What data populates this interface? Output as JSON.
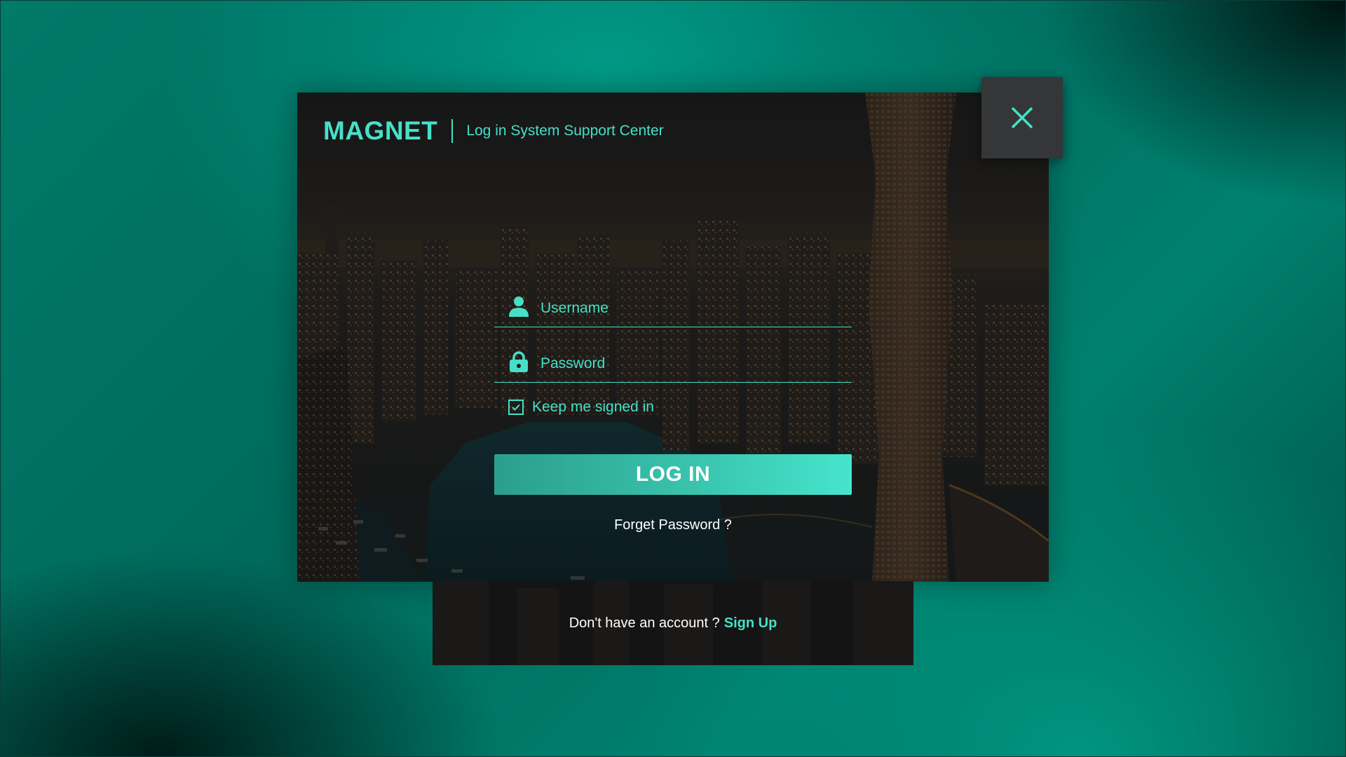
{
  "brand": {
    "name": "MAGNET",
    "subtitle": "Log in System Support Center"
  },
  "form": {
    "username_placeholder": "Username",
    "password_placeholder": "Password",
    "remember_label": "Keep me signed in",
    "remember_checked": true,
    "login_label": "LOG IN",
    "forgot_label": "Forget Password ?"
  },
  "signup": {
    "prompt": "Don't have an account ?",
    "link_label": "Sign Up"
  },
  "icons": {
    "close": "close-icon",
    "user": "user-icon",
    "lock": "lock-icon",
    "check": "checkmark-icon"
  },
  "colors": {
    "accent": "#46e0c8",
    "card_background": "#1e1f20",
    "close_background": "#353637",
    "page_teal": "#00806f"
  }
}
